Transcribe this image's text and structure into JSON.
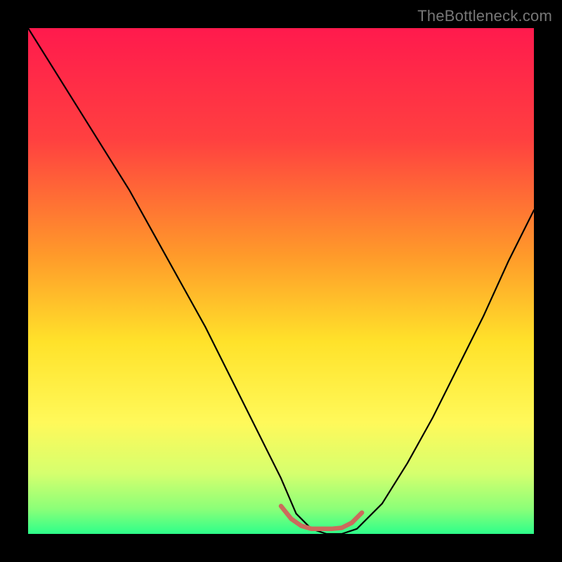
{
  "watermark": "TheBottleneck.com",
  "chart_data": {
    "type": "line",
    "title": "",
    "xlabel": "",
    "ylabel": "",
    "xlim": [
      0,
      100
    ],
    "ylim": [
      0,
      100
    ],
    "legend": false,
    "grid": false,
    "background_gradient": {
      "stops": [
        {
          "pct": 0,
          "color": "#ff1a4d"
        },
        {
          "pct": 22,
          "color": "#ff4040"
        },
        {
          "pct": 45,
          "color": "#ff9a2a"
        },
        {
          "pct": 62,
          "color": "#ffe22a"
        },
        {
          "pct": 78,
          "color": "#fff95a"
        },
        {
          "pct": 88,
          "color": "#d6ff6e"
        },
        {
          "pct": 95,
          "color": "#8cff78"
        },
        {
          "pct": 100,
          "color": "#2dff8a"
        }
      ]
    },
    "series": [
      {
        "name": "penalty-curve",
        "color": "#000000",
        "width": 2.2,
        "x": [
          0,
          5,
          10,
          15,
          20,
          25,
          30,
          35,
          40,
          45,
          50,
          53,
          56,
          59,
          62,
          65,
          70,
          75,
          80,
          85,
          90,
          95,
          100
        ],
        "y": [
          100,
          92,
          84,
          76,
          68,
          59,
          50,
          41,
          31,
          21,
          11,
          4,
          1,
          0,
          0,
          1,
          6,
          14,
          23,
          33,
          43,
          54,
          64
        ]
      },
      {
        "name": "optimal-band-marker",
        "color": "#cc6a5c",
        "width": 6.5,
        "x": [
          50,
          52,
          54,
          56,
          58,
          60,
          62,
          64,
          66
        ],
        "y": [
          5.5,
          3.0,
          1.6,
          1.0,
          1.0,
          1.0,
          1.2,
          2.2,
          4.2
        ]
      }
    ],
    "annotations": []
  }
}
